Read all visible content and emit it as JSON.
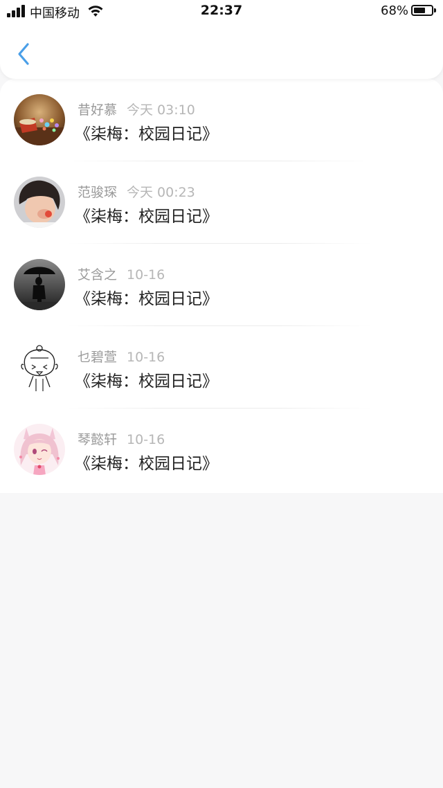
{
  "status_bar": {
    "carrier": "中国移动",
    "time": "22:37",
    "battery_percent": "68%",
    "battery_level": 0.68
  },
  "nav": {
    "back_icon": "chevron-left-icon",
    "accent_color": "#4a9fe8"
  },
  "items": [
    {
      "username": "昔好慕",
      "timestamp": "今天 03:10",
      "title": "《柒梅：校园日记》",
      "avatar": "lantern-photo-avatar"
    },
    {
      "username": "范骏琛",
      "timestamp": "今天 00:23",
      "title": "《柒梅：校园日记》",
      "avatar": "child-photo-avatar"
    },
    {
      "username": "艾含之",
      "timestamp": "10-16",
      "title": "《柒梅：校园日记》",
      "avatar": "umbrella-silhouette-avatar"
    },
    {
      "username": "乜碧萱",
      "timestamp": "10-16",
      "title": "《柒梅：校园日记》",
      "avatar": "sketch-girl-avatar"
    },
    {
      "username": "琴懿轩",
      "timestamp": "10-16",
      "title": "《柒梅：校园日记》",
      "avatar": "anime-girl-avatar"
    }
  ]
}
